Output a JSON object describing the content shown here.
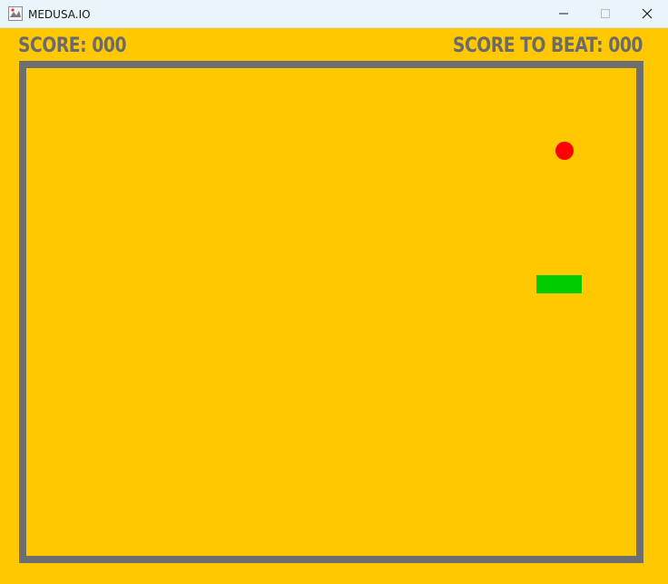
{
  "window": {
    "title": "MEDUSA.IO",
    "controls": {
      "minimize_icon": "minimize-icon",
      "maximize_icon": "maximize-icon",
      "close_icon": "close-icon"
    }
  },
  "hud": {
    "score_label": "SCORE: 000",
    "score_to_beat_label": "SCORE TO BEAT: 000"
  },
  "colors": {
    "background": "#ffc800",
    "text": "#6b6b6b",
    "wall": "#6e6e6e",
    "food": "#ff0000",
    "snake": "#00cc00"
  },
  "game": {
    "snake_length": 2
  }
}
